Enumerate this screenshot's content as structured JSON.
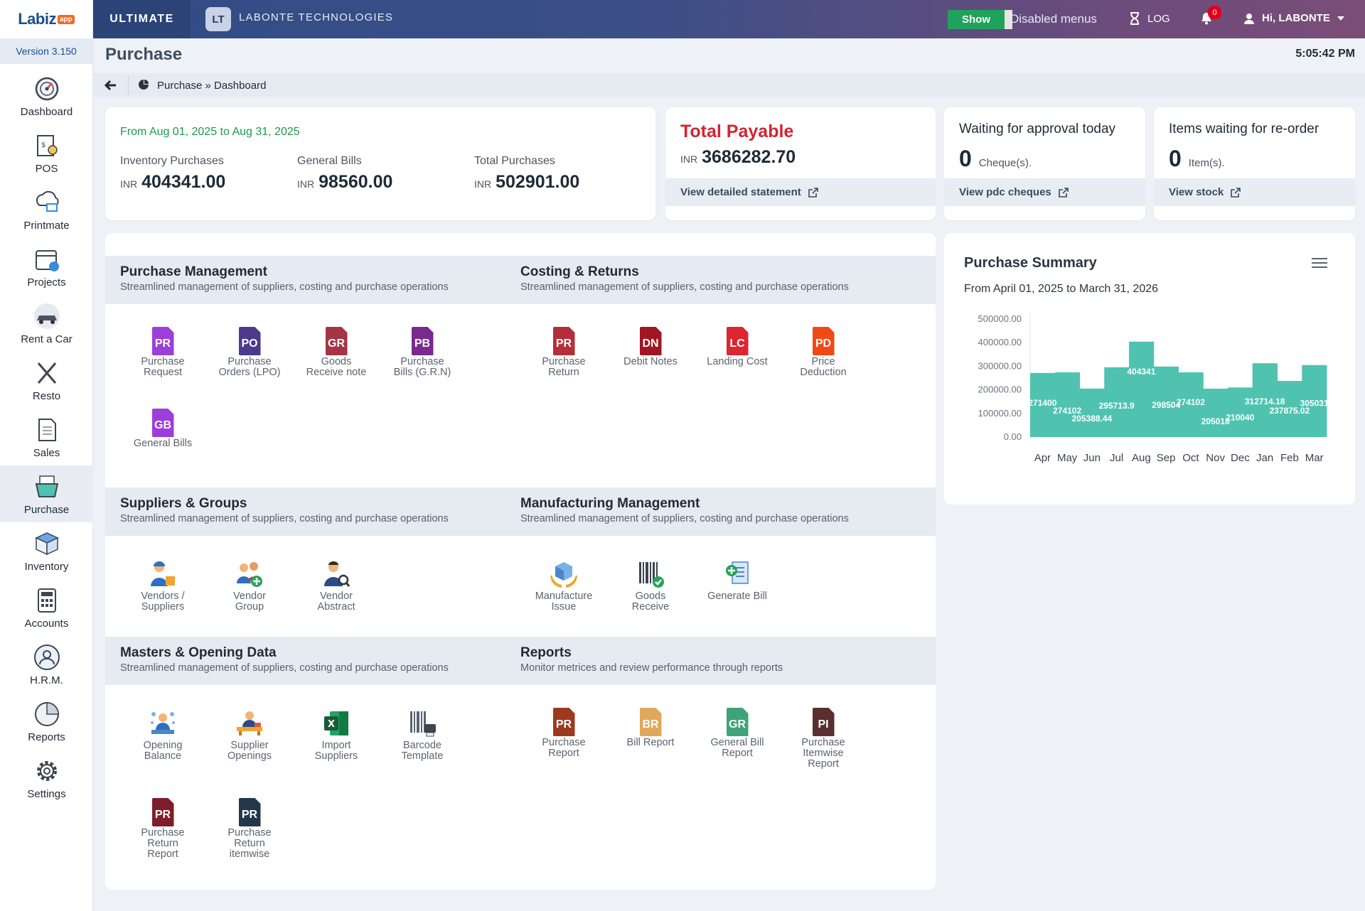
{
  "brand": {
    "logo_text": "Labiz",
    "logo_badge": "app",
    "version": "Version 3.150"
  },
  "sidebar": {
    "items": [
      {
        "label": "Dashboard",
        "icon": "dashboard-icon"
      },
      {
        "label": "POS",
        "icon": "pos-icon"
      },
      {
        "label": "Printmate",
        "icon": "printmate-icon"
      },
      {
        "label": "Projects",
        "icon": "projects-icon"
      },
      {
        "label": "Rent a Car",
        "icon": "car-icon"
      },
      {
        "label": "Resto",
        "icon": "resto-icon"
      },
      {
        "label": "Sales",
        "icon": "sales-icon"
      },
      {
        "label": "Purchase",
        "icon": "purchase-icon",
        "active": true
      },
      {
        "label": "Inventory",
        "icon": "inventory-icon"
      },
      {
        "label": "Accounts",
        "icon": "accounts-icon"
      },
      {
        "label": "H.R.M.",
        "icon": "hrm-icon"
      },
      {
        "label": "Reports",
        "icon": "reports-icon"
      },
      {
        "label": "Settings",
        "icon": "settings-icon"
      }
    ]
  },
  "topbar": {
    "plan": "ULTIMATE",
    "company_initials": "LT",
    "company_name": "LABONTE TECHNOLOGIES",
    "show_label": "Show",
    "disabled_menus": "Disabled menus",
    "log_label": "LOG",
    "notification_count": "0",
    "user_greeting": "Hi, LABONTE"
  },
  "header": {
    "title": "Purchase",
    "clock": "5:05:42 PM",
    "breadcrumb": "Purchase » Dashboard"
  },
  "stats": {
    "date_range": "From Aug 01, 2025 to Aug 31, 2025",
    "items": [
      {
        "label": "Inventory Purchases",
        "currency": "INR",
        "value": "404341.00"
      },
      {
        "label": "General Bills",
        "currency": "INR",
        "value": "98560.00"
      },
      {
        "label": "Total Purchases",
        "currency": "INR",
        "value": "502901.00"
      }
    ]
  },
  "payable": {
    "title": "Total Payable",
    "currency": "INR",
    "value": "3686282.70",
    "link": "View detailed statement"
  },
  "approval": {
    "title": "Waiting for approval today",
    "count": "0",
    "unit": "Cheque(s).",
    "link": "View pdc cheques"
  },
  "reorder": {
    "title": "Items waiting for re-order",
    "count": "0",
    "unit": "Item(s).",
    "link": "View stock"
  },
  "sections": {
    "purchase_mgmt": {
      "title": "Purchase Management",
      "subtitle": "Streamlined management of suppliers, costing and purchase operations"
    },
    "costing": {
      "title": "Costing & Returns",
      "subtitle": "Streamlined management of suppliers, costing and purchase operations"
    },
    "suppliers": {
      "title": "Suppliers & Groups",
      "subtitle": "Streamlined management of suppliers, costing and purchase operations"
    },
    "manufacturing": {
      "title": "Manufacturing Management",
      "subtitle": "Streamlined management of suppliers, costing and purchase operations"
    },
    "masters": {
      "title": "Masters & Opening Data",
      "subtitle": "Streamlined management of suppliers, costing and purchase operations"
    },
    "reports": {
      "title": "Reports",
      "subtitle": "Monitor metrices and review performance through reports"
    }
  },
  "tiles": {
    "pr": {
      "code": "PR",
      "l1": "Purchase",
      "l2": "Request",
      "color": "#9b3fd8"
    },
    "po": {
      "code": "PO",
      "l1": "Purchase",
      "l2": "Orders (LPO)",
      "color": "#4c3a8a"
    },
    "gr": {
      "code": "GR",
      "l1": "Goods",
      "l2": "Receive note",
      "color": "#a33545"
    },
    "pb": {
      "code": "PB",
      "l1": "Purchase",
      "l2": "Bills (G.R.N)",
      "color": "#7a2a8e"
    },
    "gb": {
      "code": "GB",
      "l1": "General Bills",
      "color": "#9b3fd8"
    },
    "prr": {
      "code": "PR",
      "l1": "Purchase",
      "l2": "Return",
      "color": "#b52f3a"
    },
    "dn": {
      "code": "DN",
      "l1": "Debit Notes",
      "color": "#a01623"
    },
    "lc": {
      "code": "LC",
      "l1": "Landing Cost",
      "color": "#dd2630"
    },
    "pd": {
      "code": "PD",
      "l1": "Price",
      "l2": "Deduction",
      "color": "#ef4a16"
    },
    "vendors": {
      "l1": "Vendors /",
      "l2": "Suppliers"
    },
    "vgroup": {
      "l1": "Vendor",
      "l2": "Group"
    },
    "vabstract": {
      "l1": "Vendor",
      "l2": "Abstract"
    },
    "mfg_issue": {
      "l1": "Manufacture",
      "l2": "Issue"
    },
    "goods_receive": {
      "l1": "Goods",
      "l2": "Receive"
    },
    "gen_bill": {
      "l1": "Generate Bill"
    },
    "opening": {
      "l1": "Opening",
      "l2": "Balance"
    },
    "sup_open": {
      "l1": "Supplier",
      "l2": "Openings"
    },
    "import_sup": {
      "l1": "Import",
      "l2": "Suppliers"
    },
    "barcode": {
      "l1": "Barcode",
      "l2": "Template"
    },
    "prep": {
      "code": "PR",
      "l1": "Purchase",
      "l2": "Report",
      "color": "#9c3a1f"
    },
    "brep": {
      "code": "BR",
      "l1": "Bill Report",
      "color": "#e0a85b"
    },
    "grrep": {
      "code": "GR",
      "l1": "General Bill",
      "l2": "Report",
      "color": "#3fa37a"
    },
    "pirep": {
      "code": "PI",
      "l1": "Purchase",
      "l2": "Itemwise",
      "l3": "Report",
      "color": "#5a2f2f"
    },
    "prrep": {
      "code": "PR",
      "l1": "Purchase",
      "l2": "Return",
      "l3": "Report",
      "color": "#7d1f2a"
    },
    "prit": {
      "code": "PR",
      "l1": "Purchase",
      "l2": "Return",
      "l3": "itemwise",
      "color": "#243649"
    }
  },
  "summary": {
    "title": "Purchase Summary",
    "range": "From April 01, 2025 to March 31, 2026"
  },
  "chart_data": {
    "type": "bar",
    "categories": [
      "Apr",
      "May",
      "Jun",
      "Jul",
      "Aug",
      "Sep",
      "Oct",
      "Nov",
      "Dec",
      "Jan",
      "Feb",
      "Mar"
    ],
    "values": [
      271400,
      274102,
      205388.44,
      295713.9,
      404341,
      298504,
      274102,
      205018,
      210040,
      312714.18,
      237875.02,
      305031
    ],
    "data_labels": [
      "271400",
      "274102",
      "205388.44",
      "295713.9",
      "404341",
      "298504",
      "274102",
      "205018",
      "210040",
      "312714.18",
      "237875.02",
      "305031"
    ],
    "y_ticks": [
      "500000.00",
      "400000.00",
      "300000.00",
      "200000.00",
      "100000.00",
      "0.00"
    ],
    "ylim": [
      0,
      500000
    ],
    "color": "#4fc3b0",
    "grid": false
  }
}
